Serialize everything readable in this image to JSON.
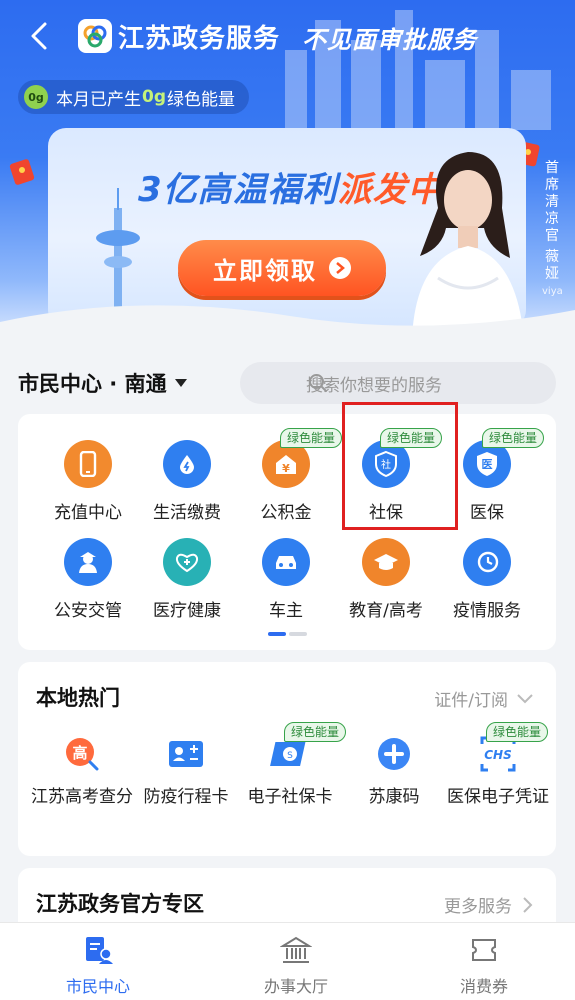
{
  "header": {
    "app_title": "江苏政务服务",
    "slogan": "不见面审批服务",
    "energy": {
      "icon_text": "0g",
      "prefix": "本月已产生",
      "value": "0g",
      "suffix": "绿色能量"
    }
  },
  "banner": {
    "headline_main": "3亿高温福利",
    "headline_highlight": "派发中",
    "cta_label": "立即领取",
    "side_caption": "首席清凉官",
    "side_name": "薇娅",
    "side_name_latin": "viya"
  },
  "city": {
    "label": "市民中心 · 南通"
  },
  "search": {
    "placeholder": "搜索你想要的服务"
  },
  "services": [
    {
      "label": "充值中心",
      "icon": "phone-icon",
      "icon_text": "",
      "color": "#f28a2e",
      "badge": ""
    },
    {
      "label": "生活缴费",
      "icon": "water-drop-icon",
      "icon_text": "",
      "color": "#2f7ff0",
      "badge": ""
    },
    {
      "label": "公积金",
      "icon": "housing-fund-icon",
      "icon_text": "¥",
      "color": "#f0852b",
      "badge": "绿色能量"
    },
    {
      "label": "社保",
      "icon": "social-security-shield-icon",
      "icon_text": "社",
      "color": "#2f7ff0",
      "badge": "绿色能量"
    },
    {
      "label": "医保",
      "icon": "medical-insurance-shield-icon",
      "icon_text": "医",
      "color": "#2f7ff0",
      "badge": "绿色能量"
    },
    {
      "label": "公安交管",
      "icon": "police-icon",
      "icon_text": "",
      "color": "#2f7ff0",
      "badge": ""
    },
    {
      "label": "医疗健康",
      "icon": "medical-kit-icon",
      "icon_text": "",
      "color": "#28b1b5",
      "badge": ""
    },
    {
      "label": "车主",
      "icon": "car-icon",
      "icon_text": "",
      "color": "#2f7ff0",
      "badge": ""
    },
    {
      "label": "教育/高考",
      "icon": "graduation-cap-icon",
      "icon_text": "",
      "color": "#f0852b",
      "badge": ""
    },
    {
      "label": "疫情服务",
      "icon": "clock-history-icon",
      "icon_text": "",
      "color": "#2f7ff0",
      "badge": ""
    }
  ],
  "hot": {
    "title": "本地热门",
    "more_label": "证件/订阅",
    "items": [
      {
        "label": "江苏高考查分",
        "icon": "exam-score-icon",
        "icon_text": "高",
        "badge": ""
      },
      {
        "label": "防疫行程卡",
        "icon": "travel-card-icon",
        "icon_text": "",
        "badge": ""
      },
      {
        "label": "电子社保卡",
        "icon": "social-security-card-icon",
        "icon_text": "",
        "badge": "绿色能量"
      },
      {
        "label": "苏康码",
        "icon": "health-code-icon",
        "icon_text": "",
        "badge": ""
      },
      {
        "label": "医保电子凭证",
        "icon": "chs-voucher-icon",
        "icon_text": "CHS",
        "badge": "绿色能量"
      }
    ]
  },
  "official": {
    "title": "江苏政务官方专区",
    "more_label": "更多服务"
  },
  "nav": [
    {
      "label": "市民中心",
      "icon": "citizen-center-icon",
      "active": true
    },
    {
      "label": "办事大厅",
      "icon": "hall-building-icon",
      "active": false
    },
    {
      "label": "消费券",
      "icon": "coupon-icon",
      "active": false
    }
  ],
  "colors": {
    "primary": "#2d6cf0",
    "accent_orange": "#ff5a2a",
    "green_badge": "#37a34a",
    "highlight_red": "#e02020"
  }
}
